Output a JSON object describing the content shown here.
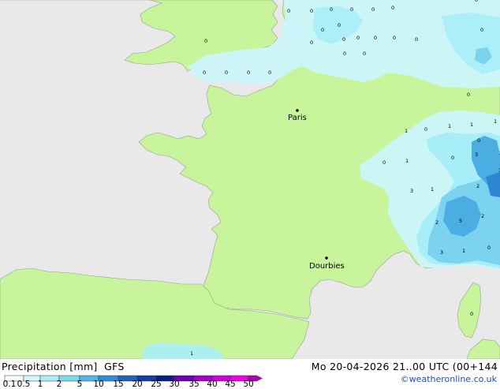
{
  "title": "Precipitation [mm]",
  "model": "GFS",
  "valid_time": "Mo 20-04-2026 21..00 UTC (00+144",
  "credit": "©weatheronline.co.uk",
  "cities": [
    {
      "name": "Paris"
    },
    {
      "name": "Dourbies"
    }
  ],
  "legend": {
    "ticks": [
      "0.1",
      "0.5",
      "1",
      "2",
      "5",
      "10",
      "15",
      "20",
      "25",
      "30",
      "35",
      "40",
      "45",
      "50"
    ],
    "colors": [
      "#f5fdfe",
      "#d2f8fd",
      "#a8eef8",
      "#7bdaf0",
      "#4fb9e6",
      "#2e8fd3",
      "#1f62bf",
      "#123da6",
      "#0a1f80",
      "#6a00b8",
      "#a300c8",
      "#d200d6",
      "#f000e6",
      "#b000b0"
    ]
  },
  "colors": {
    "sea": "#e9e9e9",
    "land": "#c8f59c",
    "light_rain": "#ccf6fb",
    "rain_1": "#a8eef8",
    "rain_2": "#7bd3ef",
    "rain_5": "#4aaee2",
    "rain_10": "#2f86d0"
  },
  "precip_values": [
    "0",
    "0",
    "0",
    "0",
    "0",
    "0",
    "0",
    "0",
    "0",
    "0",
    "0",
    "0",
    "0",
    "0",
    "0",
    "0",
    "0",
    "0",
    "0",
    "0",
    "0",
    "0",
    "0",
    "1",
    "0",
    "1",
    "1",
    "0",
    "1",
    "0",
    "1",
    "0",
    "0",
    "2",
    "3",
    "1",
    "3",
    "1",
    "2",
    "2",
    "5",
    "2",
    "3",
    "1",
    "0"
  ]
}
